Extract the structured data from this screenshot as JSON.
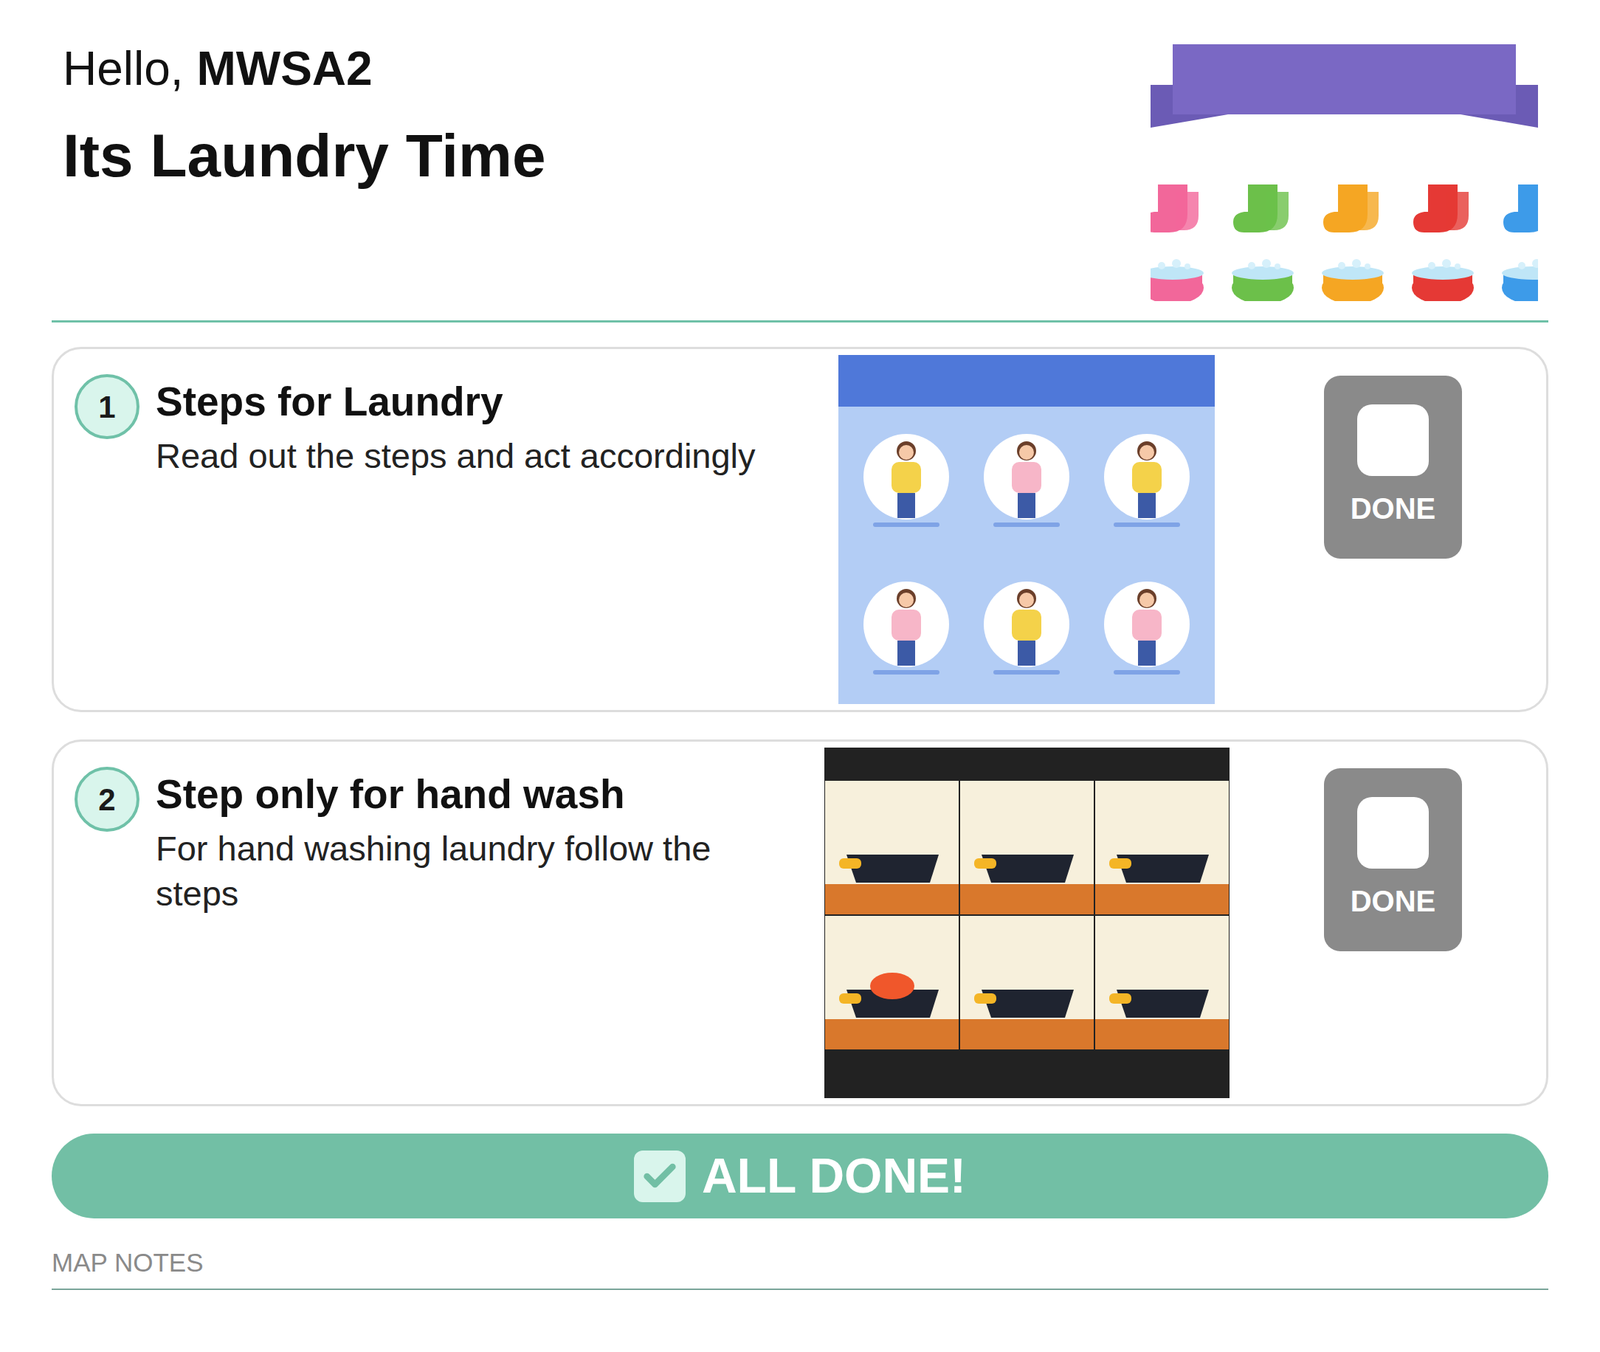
{
  "greeting": {
    "prefix": "Hello, ",
    "user": "MWSA2"
  },
  "title": "Its Laundry Time",
  "steps": [
    {
      "number": "1",
      "title": "Steps for Laundry",
      "description": "Read out the steps and act accordingly",
      "kind": "machine",
      "done_label": "DONE",
      "done": false
    },
    {
      "number": "2",
      "title": "Step only for hand wash",
      "description": "For hand washing laundry follow the steps",
      "kind": "hand",
      "done_label": "DONE",
      "done": false
    }
  ],
  "all_done": {
    "label": "ALL DONE!"
  },
  "notes": {
    "label": "MAP NOTES"
  }
}
